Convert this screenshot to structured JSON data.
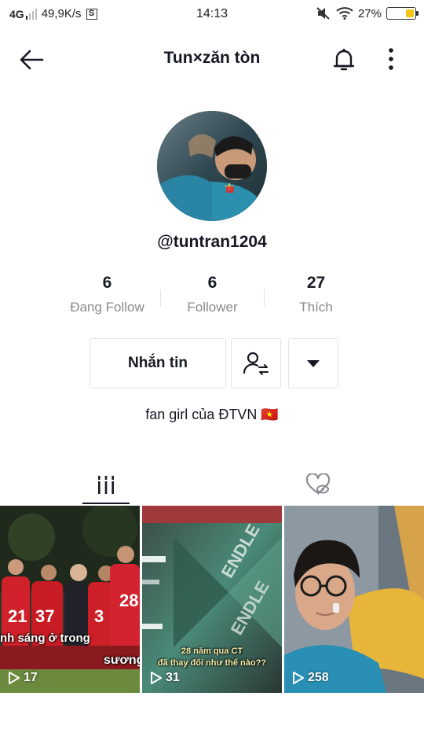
{
  "status_bar": {
    "network": "4G",
    "speed": "49,9K/s",
    "sim_badge": "S",
    "time": "14:13",
    "battery_percent": "27%",
    "battery_level": 0.27
  },
  "header": {
    "title": "Tun×zăn tòn",
    "back_icon": "arrow-left-icon",
    "bell_icon": "bell-icon",
    "more_icon": "vertical-dots-icon"
  },
  "profile": {
    "username": "@tuntran1204",
    "bio": "fan girl của ĐTVN 🇻🇳"
  },
  "stats": [
    {
      "value": "6",
      "label": "Đang Follow"
    },
    {
      "value": "6",
      "label": "Follower"
    },
    {
      "value": "27",
      "label": "Thích"
    }
  ],
  "actions": {
    "message_label": "Nhắn tin",
    "follow_icon": "person-swap-icon",
    "dropdown_icon": "triangle-down-icon"
  },
  "tabs": [
    {
      "icon": "grid-videos-icon",
      "active": true
    },
    {
      "icon": "liked-hidden-icon",
      "active": false
    }
  ],
  "videos": [
    {
      "views": "17",
      "caption_line1": "nh sáng ở trong",
      "caption_line2": "sương"
    },
    {
      "views": "31",
      "caption_line1": "28 năm qua CT",
      "caption_line2": "đã thay đổi như thế nào??",
      "overlay_text": "ENDLE"
    },
    {
      "views": "258"
    }
  ],
  "colors": {
    "text_primary": "#161823",
    "text_secondary": "#8a8b91",
    "border": "#e3e3e4",
    "battery": "#f5c518"
  }
}
